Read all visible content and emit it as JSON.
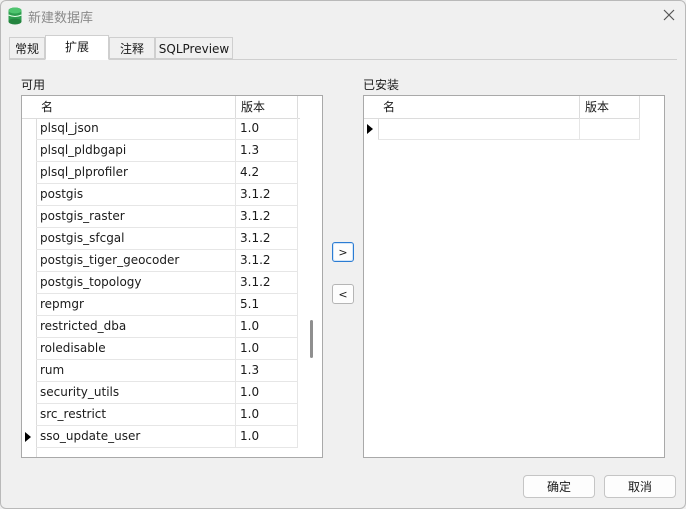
{
  "window": {
    "title": "新建数据库"
  },
  "tabs": [
    {
      "label": "常规",
      "active": false
    },
    {
      "label": "扩展",
      "active": true
    },
    {
      "label": "注释",
      "active": false
    },
    {
      "label": "SQLPreview",
      "active": false
    }
  ],
  "available": {
    "label": "可用",
    "columns": {
      "name": "名",
      "version": "版本"
    },
    "rows": [
      {
        "name": "plsql_json",
        "version": "1.0"
      },
      {
        "name": "plsql_pldbgapi",
        "version": "1.3"
      },
      {
        "name": "plsql_plprofiler",
        "version": "4.2"
      },
      {
        "name": "postgis",
        "version": "3.1.2"
      },
      {
        "name": "postgis_raster",
        "version": "3.1.2"
      },
      {
        "name": "postgis_sfcgal",
        "version": "3.1.2"
      },
      {
        "name": "postgis_tiger_geocoder",
        "version": "3.1.2"
      },
      {
        "name": "postgis_topology",
        "version": "3.1.2"
      },
      {
        "name": "repmgr",
        "version": "5.1"
      },
      {
        "name": "restricted_dba",
        "version": "1.0"
      },
      {
        "name": "roledisable",
        "version": "1.0"
      },
      {
        "name": "rum",
        "version": "1.3"
      },
      {
        "name": "security_utils",
        "version": "1.0"
      },
      {
        "name": "src_restrict",
        "version": "1.0"
      },
      {
        "name": "sso_update_user",
        "version": "1.0",
        "current": true
      }
    ]
  },
  "installed": {
    "label": "已安装",
    "columns": {
      "name": "名",
      "version": "版本"
    },
    "rows": [
      {
        "name": "",
        "version": "",
        "current": true
      }
    ]
  },
  "buttons": {
    "add": ">",
    "remove": "<",
    "ok": "确定",
    "cancel": "取消"
  },
  "icons": {
    "app": "database-icon",
    "close": "close-icon"
  }
}
